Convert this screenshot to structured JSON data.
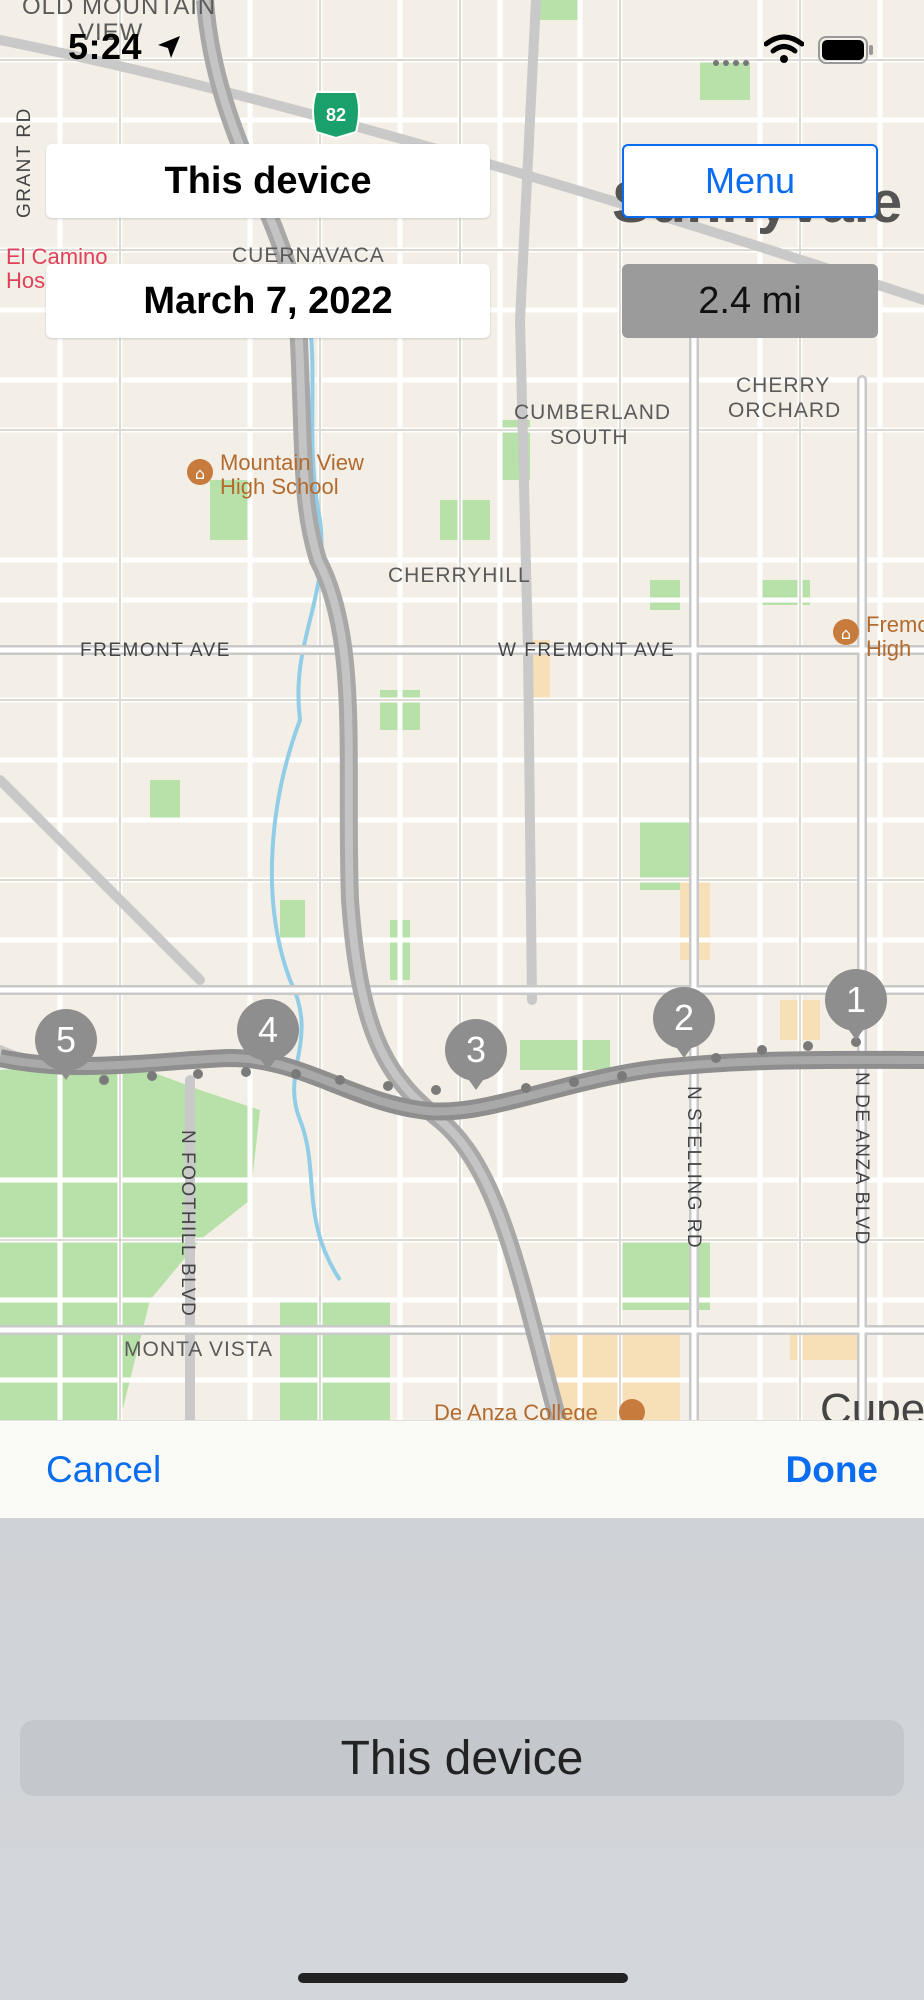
{
  "status_bar": {
    "time": "5:24"
  },
  "header": {
    "device_label": "This device",
    "date_label": "March 7, 2022",
    "menu_label": "Menu",
    "distance_label": "2.4 mi"
  },
  "map": {
    "place_labels": {
      "old_mountain_view_1": "OLD MOUNTAIN",
      "old_mountain_view_2": "VIEW",
      "cuernavaca": "CUERNAVACA",
      "sunnyvale": "Sunnyvale",
      "cumberland_1": "CUMBERLAND",
      "cumberland_2": "SOUTH",
      "cherry_orchard_1": "CHERRY",
      "cherry_orchard_2": "ORCHARD",
      "cherryhill": "CHERRYHILL",
      "monta_vista": "MONTA VISTA",
      "cupertino": "Cupe"
    },
    "road_labels": {
      "grant_rd": "GRANT RD",
      "fremont_ave": "FREMONT AVE",
      "w_fremont_ave": "W FREMONT AVE",
      "n_foothill_blvd": "N FOOTHILL BLVD",
      "n_stelling_rd": "N STELLING RD",
      "n_de_anza_blvd": "N DE ANZA BLVD"
    },
    "poi_labels": {
      "el_camino_1": "El Camino",
      "el_camino_2": "Hos",
      "mv_high_1": "Mountain View",
      "mv_high_2": "High School",
      "fremont_high_1": "Fremo",
      "fremont_high_2": "High",
      "de_anza_college": "De Anza College"
    },
    "highway_shield": "82",
    "route_pins": [
      "1",
      "2",
      "3",
      "4",
      "5"
    ]
  },
  "toolbar": {
    "cancel_label": "Cancel",
    "done_label": "Done"
  },
  "picker": {
    "selected_label": "This device"
  },
  "colors": {
    "accent": "#0a6cf0",
    "map_background": "#f3efe6",
    "park": "#a8dca0",
    "pin": "#8e8e8e"
  }
}
